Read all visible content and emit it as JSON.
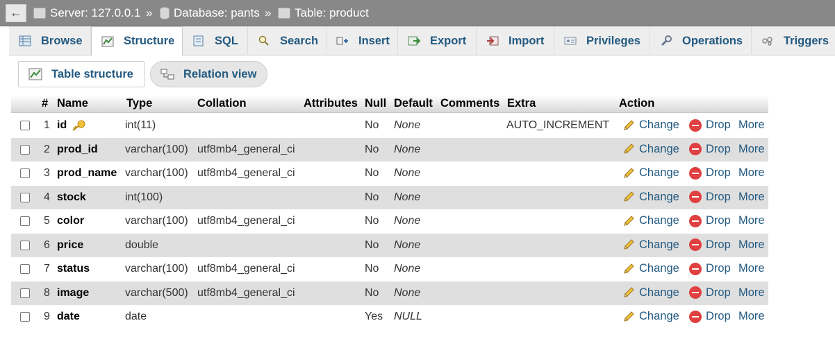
{
  "breadcrumb": {
    "back_label": "←",
    "server": "Server: 127.0.0.1",
    "database": "Database: pants",
    "table": "Table: product",
    "separator": "»"
  },
  "tabs": [
    {
      "label": "Browse",
      "icon": "browse-icon"
    },
    {
      "label": "Structure",
      "icon": "structure-icon",
      "active": true
    },
    {
      "label": "SQL",
      "icon": "sql-icon"
    },
    {
      "label": "Search",
      "icon": "search-icon"
    },
    {
      "label": "Insert",
      "icon": "insert-icon"
    },
    {
      "label": "Export",
      "icon": "export-icon"
    },
    {
      "label": "Import",
      "icon": "import-icon"
    },
    {
      "label": "Privileges",
      "icon": "privileges-icon"
    },
    {
      "label": "Operations",
      "icon": "wrench-icon"
    },
    {
      "label": "Triggers",
      "icon": "triggers-icon"
    }
  ],
  "subtabs": {
    "table_structure": "Table structure",
    "relation_view": "Relation view"
  },
  "columns": {
    "num": "#",
    "name": "Name",
    "type": "Type",
    "collation": "Collation",
    "attributes": "Attributes",
    "null": "Null",
    "default": "Default",
    "comments": "Comments",
    "extra": "Extra",
    "action": "Action"
  },
  "actions": {
    "change": "Change",
    "drop": "Drop",
    "more": "More"
  },
  "rows": [
    {
      "num": "1",
      "name": "id",
      "type": "int(11)",
      "collation": "",
      "null": "No",
      "default": "None",
      "extra": "AUTO_INCREMENT",
      "primary_key": true
    },
    {
      "num": "2",
      "name": "prod_id",
      "type": "varchar(100)",
      "collation": "utf8mb4_general_ci",
      "null": "No",
      "default": "None",
      "extra": ""
    },
    {
      "num": "3",
      "name": "prod_name",
      "type": "varchar(100)",
      "collation": "utf8mb4_general_ci",
      "null": "No",
      "default": "None",
      "extra": ""
    },
    {
      "num": "4",
      "name": "stock",
      "type": "int(100)",
      "collation": "",
      "null": "No",
      "default": "None",
      "extra": ""
    },
    {
      "num": "5",
      "name": "color",
      "type": "varchar(100)",
      "collation": "utf8mb4_general_ci",
      "null": "No",
      "default": "None",
      "extra": ""
    },
    {
      "num": "6",
      "name": "price",
      "type": "double",
      "collation": "",
      "null": "No",
      "default": "None",
      "extra": ""
    },
    {
      "num": "7",
      "name": "status",
      "type": "varchar(100)",
      "collation": "utf8mb4_general_ci",
      "null": "No",
      "default": "None",
      "extra": ""
    },
    {
      "num": "8",
      "name": "image",
      "type": "varchar(500)",
      "collation": "utf8mb4_general_ci",
      "null": "No",
      "default": "None",
      "extra": ""
    },
    {
      "num": "9",
      "name": "date",
      "type": "date",
      "collation": "",
      "null": "Yes",
      "default": "NULL",
      "extra": ""
    }
  ],
  "colors": {
    "link": "#235a81",
    "topbar": "#888888",
    "row_alt": "#dfdfdf",
    "drop_icon": "#e04040"
  }
}
